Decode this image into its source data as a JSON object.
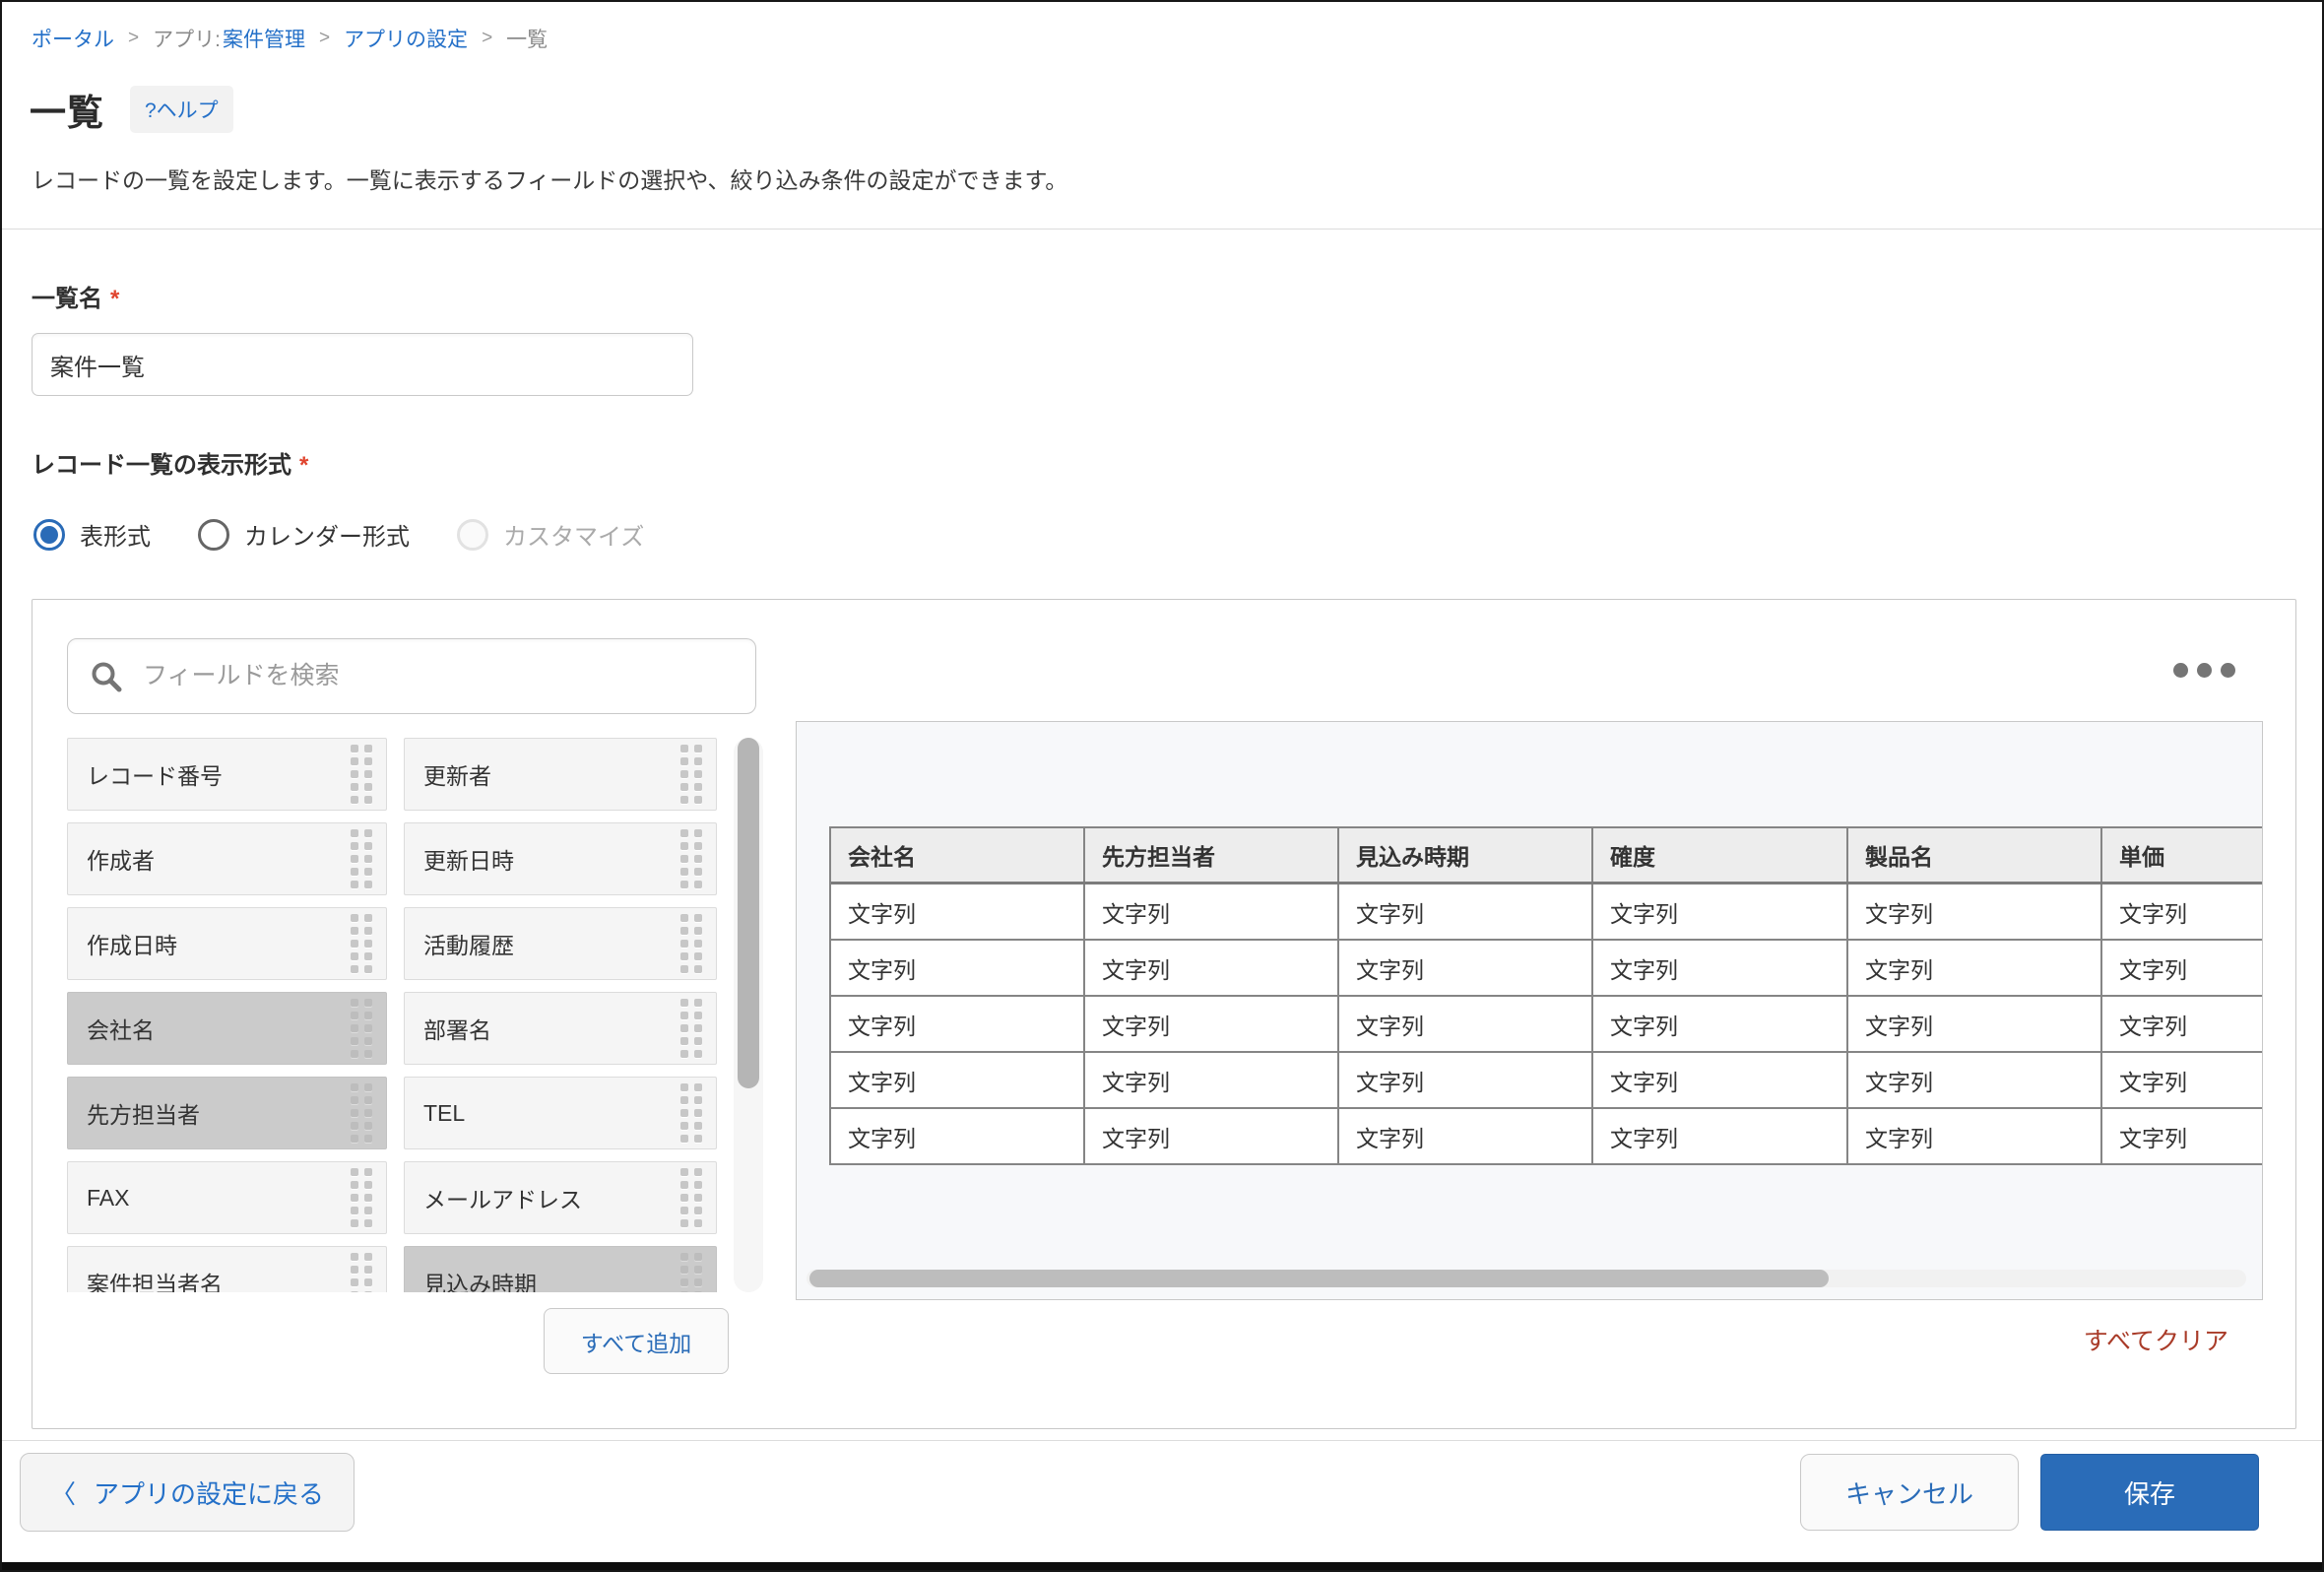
{
  "breadcrumb": {
    "portal": "ポータル",
    "sep": ">",
    "app_prefix": "アプリ:",
    "app_name": "案件管理",
    "settings": "アプリの設定",
    "current": "一覧"
  },
  "header": {
    "title": "一覧",
    "help_label": "?ヘルプ",
    "description": "レコードの一覧を設定します。一覧に表示するフィールドの選択や、絞り込み条件の設定ができます。"
  },
  "form": {
    "name_label": "一覧名",
    "required_mark": "*",
    "name_value": "案件一覧",
    "format_label": "レコード一覧の表示形式",
    "format_options": {
      "table": "表形式",
      "calendar": "カレンダー形式",
      "customize": "カスタマイズ"
    },
    "format_selected": "表形式"
  },
  "picker": {
    "search_placeholder": "フィールドを検索",
    "fields_left": [
      {
        "label": "レコード番号",
        "used": false
      },
      {
        "label": "作成者",
        "used": false
      },
      {
        "label": "作成日時",
        "used": false
      },
      {
        "label": "会社名",
        "used": true
      },
      {
        "label": "先方担当者",
        "used": true
      },
      {
        "label": "FAX",
        "used": false
      },
      {
        "label": "案件担当者名",
        "used": false
      }
    ],
    "fields_right": [
      {
        "label": "更新者",
        "used": false
      },
      {
        "label": "更新日時",
        "used": false
      },
      {
        "label": "活動履歴",
        "used": false
      },
      {
        "label": "部署名",
        "used": false
      },
      {
        "label": "TEL",
        "used": false
      },
      {
        "label": "メールアドレス",
        "used": false
      },
      {
        "label": "見込み時期",
        "used": true
      }
    ],
    "add_all_label": "すべて追加",
    "clear_all_label": "すべてクリア"
  },
  "preview": {
    "columns": [
      "会社名",
      "先方担当者",
      "見込み時期",
      "確度",
      "製品名",
      "単価"
    ],
    "cell_text": "文字列",
    "row_count": 5
  },
  "footer": {
    "back_chevron": "〈",
    "back_label": "アプリの設定に戻る",
    "cancel_label": "キャンセル",
    "save_label": "保存"
  },
  "colors": {
    "accent_blue": "#2a6cb8",
    "link_blue": "#2470c8",
    "danger_red": "#a93b28",
    "required_red": "#e0442e",
    "used_chip_gray": "#cbcbcb"
  }
}
